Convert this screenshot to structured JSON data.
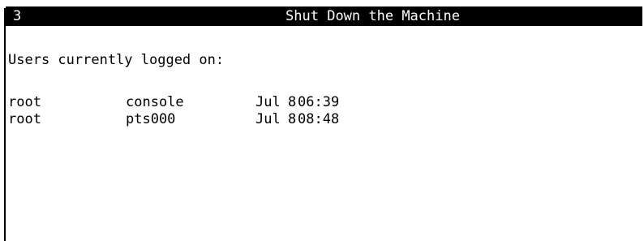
{
  "window": {
    "number": "3",
    "title": "Shut Down the Machine"
  },
  "main": {
    "heading": "Users currently logged on:",
    "users": [
      {
        "user": "root",
        "tty": "console",
        "month": "Jul",
        "day": "8",
        "time": "06:39"
      },
      {
        "user": "root",
        "tty": "pts000",
        "month": "Jul",
        "day": "8",
        "time": "08:48"
      }
    ]
  },
  "colors": {
    "background": "#ffffff",
    "foreground": "#000000",
    "title_bar": "#000000",
    "title_text": "#ffffff"
  }
}
